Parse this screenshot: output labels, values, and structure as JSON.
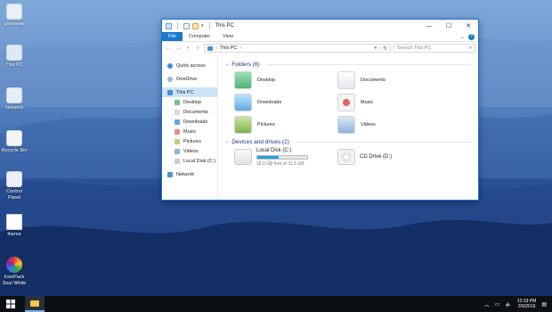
{
  "desktop": {
    "icons": [
      {
        "label": "giveaway",
        "icon": "user-folder-icon"
      },
      {
        "label": "This PC",
        "icon": "computer-icon"
      },
      {
        "label": "Network",
        "icon": "network-icon"
      },
      {
        "label": "Recycle Bin",
        "icon": "recycle-bin-icon"
      },
      {
        "label": "Control Panel",
        "icon": "control-panel-icon"
      },
      {
        "label": "theme",
        "icon": "file-icon"
      },
      {
        "label": "IconPack Soul White",
        "icon": "iconpack-icon"
      }
    ]
  },
  "window": {
    "title": "This PC",
    "controls": {
      "minimize": "—",
      "maximize": "☐",
      "close": "✕"
    },
    "ribbon": {
      "file": "File",
      "tabs": [
        "Computer",
        "View"
      ],
      "help": "?"
    },
    "address": {
      "back": "←",
      "forward": "→",
      "up": "↑",
      "path": "This PC",
      "separator": "›"
    },
    "search": {
      "placeholder": "Search This PC"
    },
    "nav": {
      "quick_access": "Quick access",
      "onedrive": "OneDrive",
      "this_pc": "This PC",
      "sub": [
        "Desktop",
        "Documents",
        "Downloads",
        "Music",
        "Pictures",
        "Videos",
        "Local Disk (C:)"
      ],
      "network": "Network"
    },
    "folders": {
      "header": "Folders (6)",
      "items": [
        "Desktop",
        "Documents",
        "Downloads",
        "Music",
        "Pictures",
        "Videos"
      ]
    },
    "devices": {
      "header": "Devices and drives (2)",
      "local_disk": {
        "label": "Local Disk (C:)",
        "free_text": "18.0 GB free of 31.5 GB",
        "used_fraction": 0.43
      },
      "cd_drive": {
        "label": "CD Drive (D:)"
      }
    }
  },
  "taskbar": {
    "time": "12:19 PM",
    "date": "2/9/2016"
  },
  "colors": {
    "accent": "#1979ca",
    "header": "#1e3287",
    "selection": "#cce4f7",
    "bar": "#26a0da"
  }
}
